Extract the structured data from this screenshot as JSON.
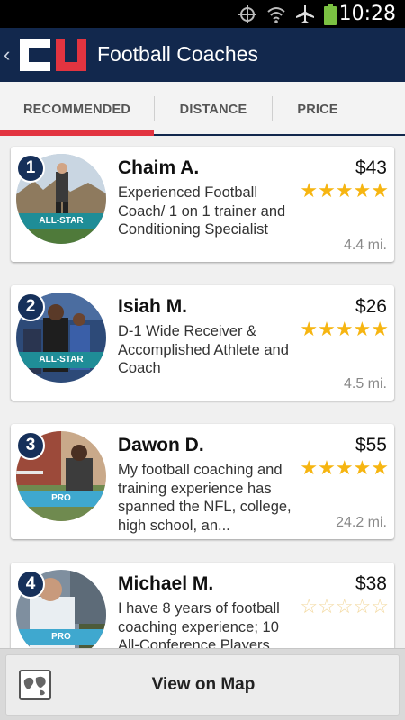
{
  "status_bar": {
    "time": "10:28",
    "icons": [
      "location-icon",
      "wifi-icon",
      "airplane-icon",
      "battery-icon"
    ]
  },
  "app_bar": {
    "back_glyph": "‹",
    "logo": "CU",
    "title": "Football Coaches"
  },
  "tabs": [
    {
      "label": "RECOMMENDED",
      "active": true
    },
    {
      "label": "DISTANCE",
      "active": false
    },
    {
      "label": "PRICE",
      "active": false
    }
  ],
  "coaches": [
    {
      "rank": "1",
      "name": "Chaim A.",
      "price": "$43",
      "description": "Experienced Football Coach/ 1 on 1 trainer and Conditioning Specialist",
      "rating": 5,
      "distance": "4.4 mi.",
      "badge": "ALL-STAR",
      "badge_color": "#1f8d97"
    },
    {
      "rank": "2",
      "name": "Isiah M.",
      "price": "$26",
      "description": "D-1 Wide Receiver & Accomplished Athlete and Coach",
      "rating": 5,
      "distance": "4.5 mi.",
      "badge": "ALL-STAR",
      "badge_color": "#1f8d97"
    },
    {
      "rank": "3",
      "name": "Dawon D.",
      "price": "$55",
      "description": "My football coaching and training experience has spanned the NFL, college, high school, an...",
      "rating": 5,
      "distance": "24.2 mi.",
      "badge": "PRO",
      "badge_color": "#3fa8cf"
    },
    {
      "rank": "4",
      "name": "Michael M.",
      "price": "$38",
      "description": "I have 8 years of football coaching experience; 10 All-Conference Players",
      "rating": 0,
      "distance": "",
      "badge": "PRO",
      "badge_color": "#3fa8cf"
    }
  ],
  "map_button": {
    "label": "View on Map"
  },
  "colors": {
    "primary": "#12284d",
    "accent": "#e23440",
    "star": "#f6b511"
  }
}
